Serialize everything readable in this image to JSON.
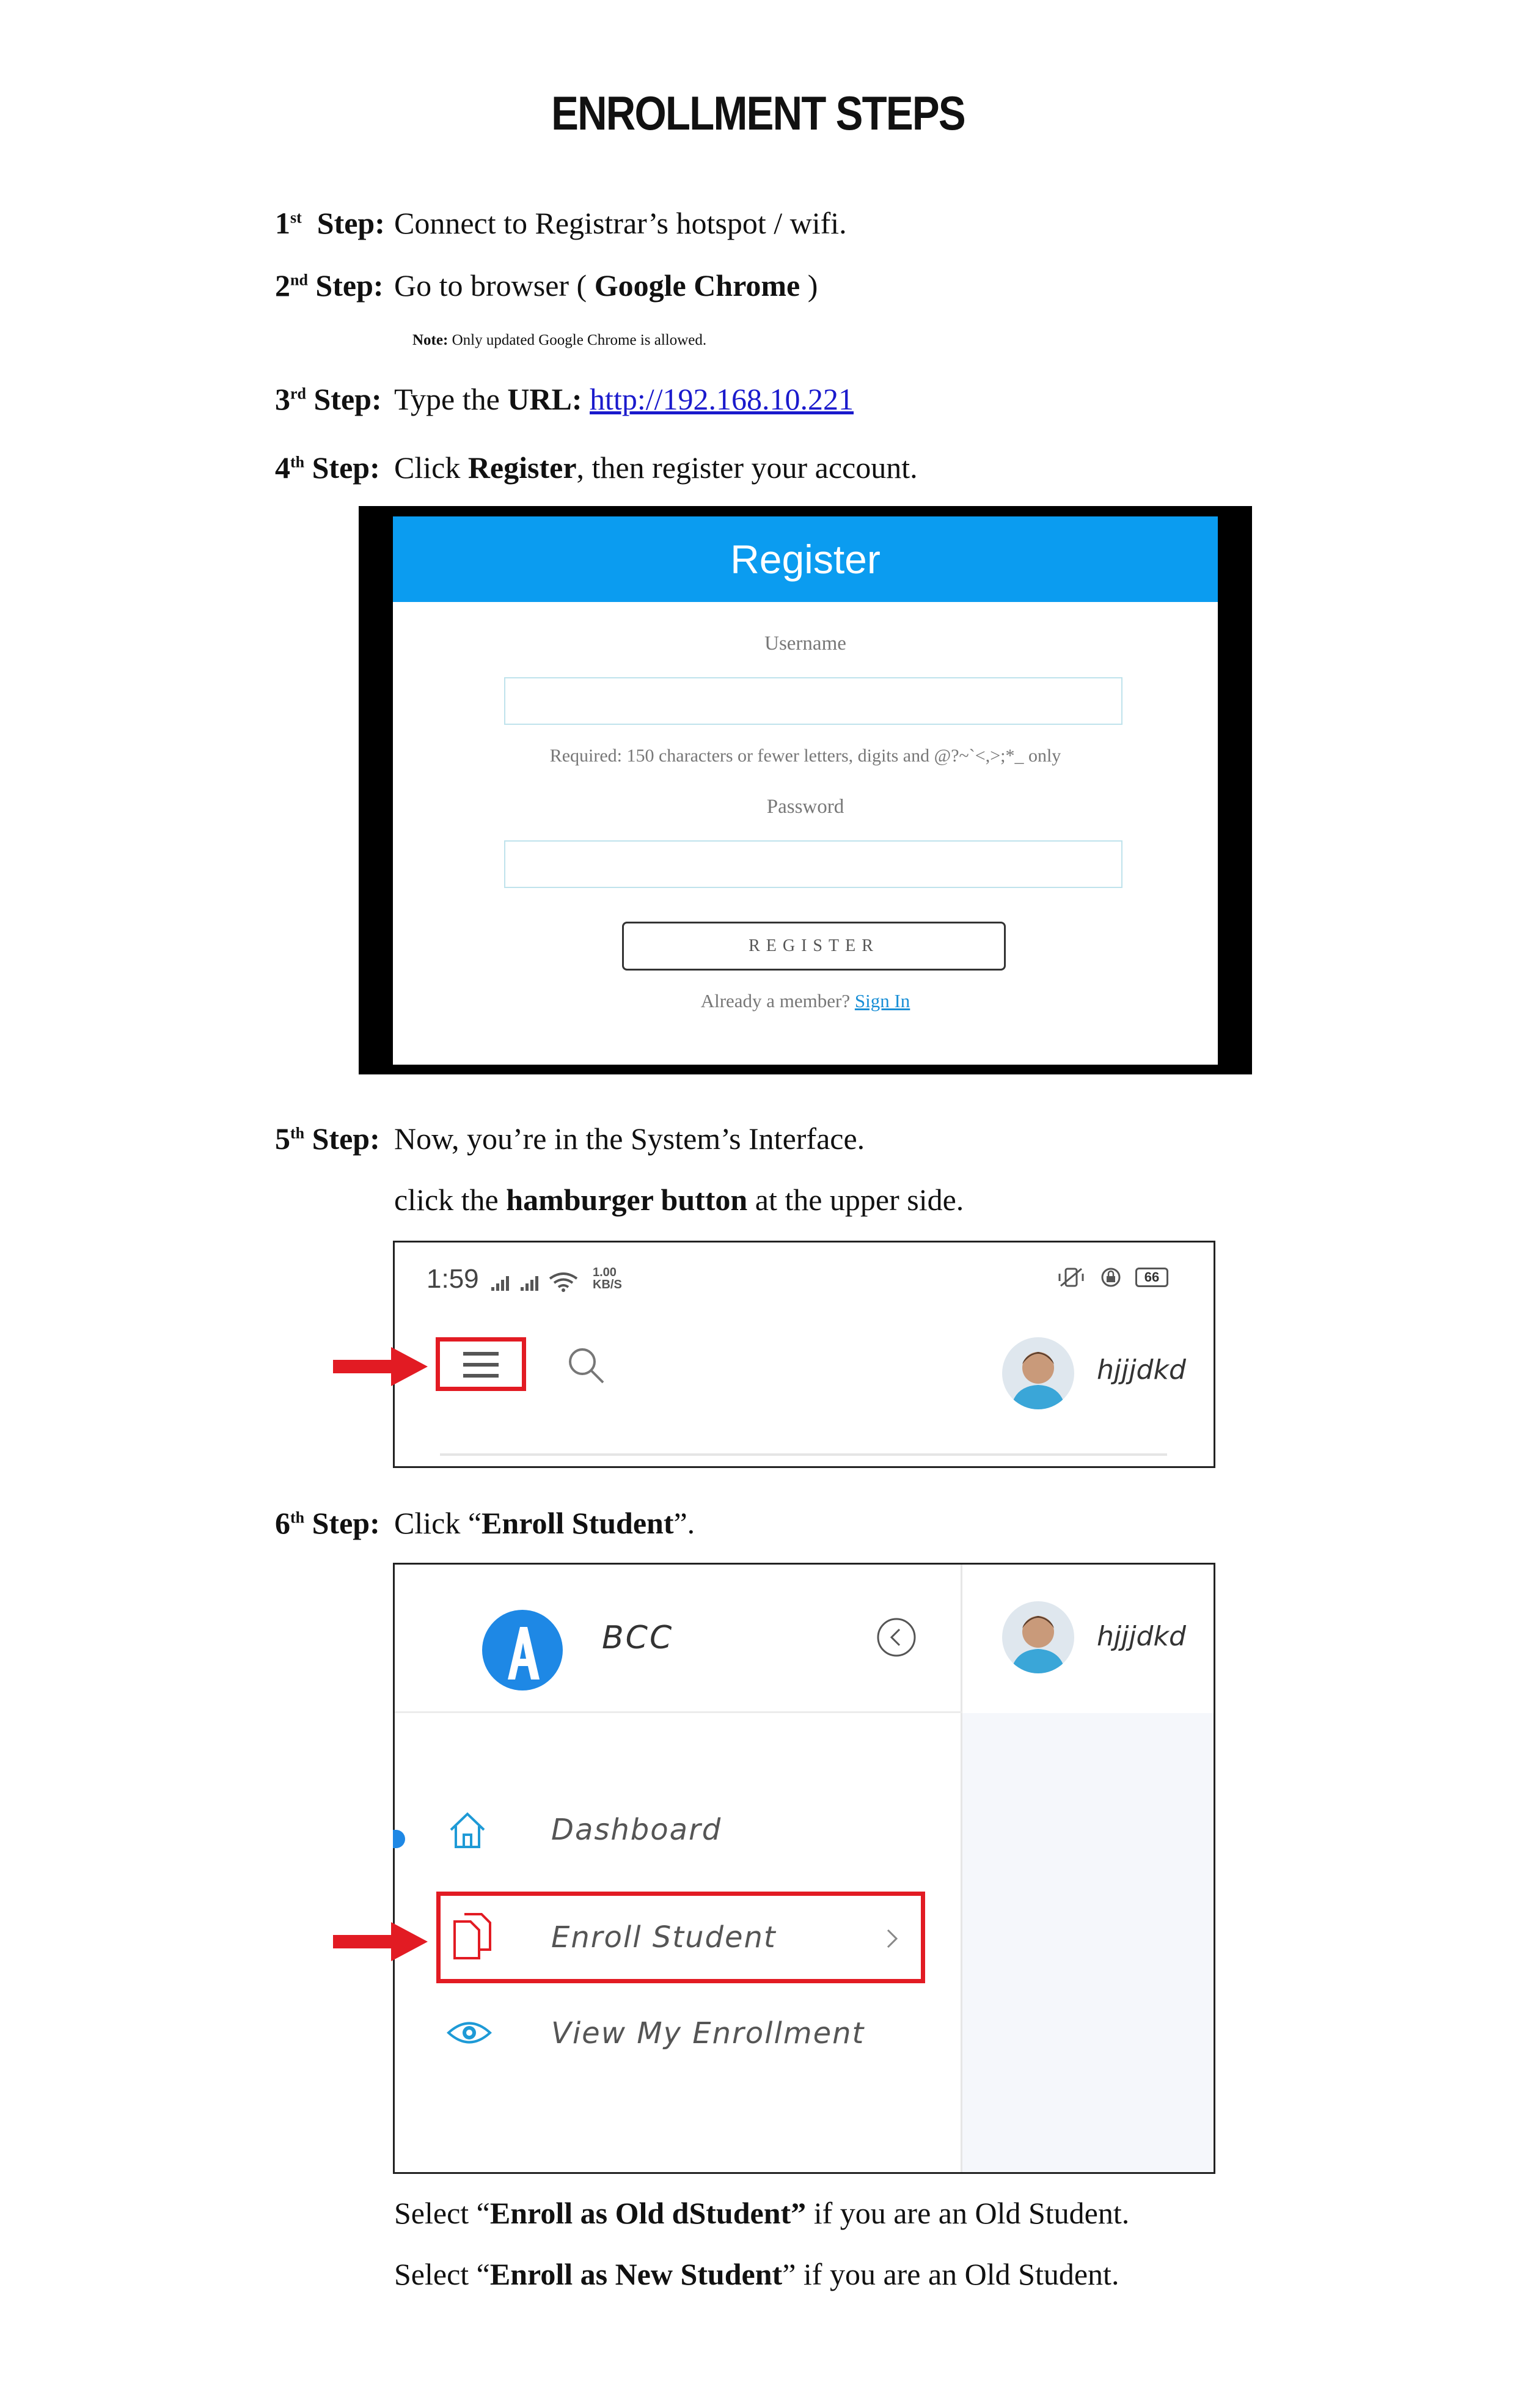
{
  "title": "ENROLLMENT STEPS",
  "steps": [
    {
      "num": "1",
      "sup": "st",
      "word": "Step:",
      "text_before": "Connect to Registrar’s hotspot / wifi."
    },
    {
      "num": "2",
      "sup": "nd",
      "word": "Step:",
      "text_before": "Go to browser ( ",
      "bold": "Google Chrome",
      "text_after": " )",
      "note_bold": "Note:",
      "note_text": " Only updated Google Chrome is allowed."
    },
    {
      "num": "3",
      "sup": "rd",
      "word": "Step:",
      "text_before": "Type the ",
      "bold": "URL:",
      "link": "http://192.168.10.221"
    },
    {
      "num": "4",
      "sup": "th",
      "word": "Step:",
      "text_before": "Click ",
      "bold": "Register",
      "text_after": ", then register your account."
    },
    {
      "num": "5",
      "sup": "th",
      "word": "Step:",
      "text_before": "Now, you’re in the System’s Interface.",
      "line2_before": "click the ",
      "line2_bold": "hamburger button",
      "line2_after": " at the upper side."
    },
    {
      "num": "6",
      "sup": "th",
      "word": "Step:",
      "text_before": "Click “",
      "bold": "Enroll Student",
      "text_after": "”."
    }
  ],
  "register_form": {
    "header": "Register",
    "username_label": "Username",
    "help_text": "Required: 150 characters or fewer letters, digits and @?~`<,>;*_ only",
    "password_label": "Password",
    "button": "REGISTER",
    "member_text": "Already a member? ",
    "signin_link": "Sign In",
    "header_color": "#0b9cf0"
  },
  "topbar": {
    "time": "1:59",
    "speed_value": "1.00",
    "speed_unit": "KB/S",
    "battery": "66",
    "username": "hjjjdkd",
    "icons": [
      "signal-icon",
      "wifi-icon",
      "vibrate-icon",
      "lock-rotation-icon",
      "battery-icon",
      "hamburger-icon",
      "search-icon"
    ]
  },
  "sidebar": {
    "brand": "BCC",
    "username": "hjjjdkd",
    "items": [
      {
        "label": "Dashboard",
        "icon": "home-icon"
      },
      {
        "label": "Enroll Student",
        "icon": "document-icon"
      },
      {
        "label": "View My Enrollment",
        "icon": "eye-icon"
      }
    ],
    "accent": "#1e88e5",
    "highlight": "#e21b23"
  },
  "tail": [
    {
      "before": "Select “",
      "bold": "Enroll as Old dStudent”",
      "after": " if you are an Old Student."
    },
    {
      "before": "Select “",
      "bold": "Enroll as New Student",
      "after": "” if you are an Old Student."
    }
  ]
}
